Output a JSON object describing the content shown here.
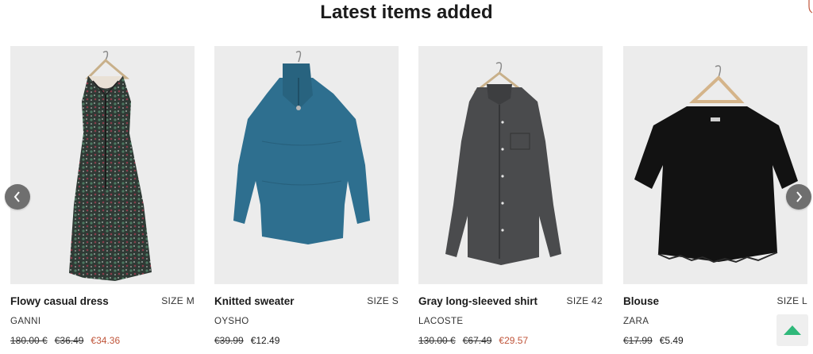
{
  "section": {
    "title": "Latest items added"
  },
  "icons": {
    "prev": "chevron-left-icon",
    "next": "chevron-right-icon",
    "scroll_top": "triangle-up-icon"
  },
  "colors": {
    "sale_price": "#c0553a",
    "image_bg": "#ececec",
    "scroll_top_accent": "#2fb87a",
    "nav_bg": "#6f6f6f"
  },
  "products": [
    {
      "title": "Flowy casual dress",
      "size": "SIZE M",
      "brand": "GANNI",
      "original_price": "180.00 €",
      "old_price": "€36.49",
      "price": "€34.36",
      "image": "floral-dress"
    },
    {
      "title": "Knitted sweater",
      "size": "SIZE S",
      "brand": "OYSHO",
      "old_price": "€39.99",
      "price": "€12.49",
      "image": "blue-sweater"
    },
    {
      "title": "Gray long-sleeved shirt",
      "size": "SIZE 42",
      "brand": "LACOSTE",
      "original_price": "130.00 €",
      "old_price": "€67.49",
      "price": "€29.57",
      "image": "gray-shirt"
    },
    {
      "title": "Blouse",
      "size": "SIZE L",
      "brand": "ZARA",
      "old_price": "€17.99",
      "price": "€5.49",
      "image": "black-blouse"
    }
  ]
}
